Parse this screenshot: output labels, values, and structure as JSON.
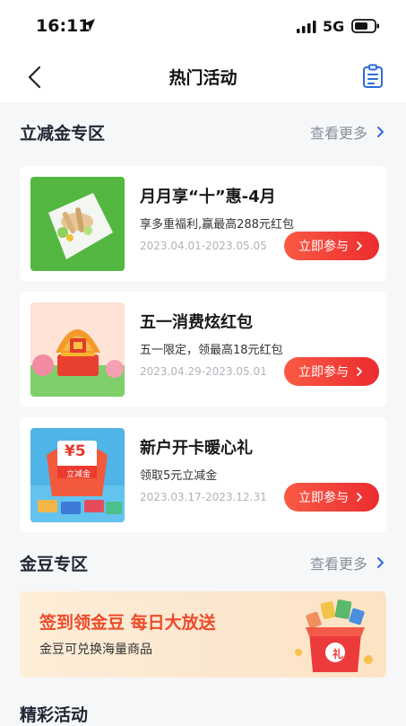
{
  "status_bar": {
    "time": "16:11",
    "network": "5G",
    "icons": [
      "location-arrow-icon",
      "signal-icon",
      "battery-icon"
    ]
  },
  "nav": {
    "title": "热门活动",
    "icons": [
      "back-icon",
      "document-icon"
    ]
  },
  "sections": {
    "discount": {
      "title": "立减金专区",
      "more": "查看更多"
    },
    "gold_beans": {
      "title": "金豆专区",
      "more": "查看更多"
    },
    "featured": {
      "title": "精彩活动"
    }
  },
  "activities": [
    {
      "title": "月月享“十”惠-4月",
      "desc": "享多重福利,赢最高288元红包",
      "date": "2023.04.01-2023.05.05",
      "button": "立即参与"
    },
    {
      "title": "五一消费炫红包",
      "desc": "五一限定，领最高18元红包",
      "date": "2023.04.29-2023.05.01",
      "button": "立即参与"
    },
    {
      "title": "新户开卡暖心礼",
      "desc": "领取5元立减金",
      "date": "2023.03.17-2023.12.31",
      "button": "立即参与"
    }
  ],
  "voucher_art": {
    "amount": "¥5",
    "label": "立减金"
  },
  "gold_banner": {
    "title": "签到领金豆  每日大放送",
    "subtitle": "金豆可兑换海量商品",
    "gift_char": "礼"
  },
  "colors": {
    "accent_red": "#ec2c2f",
    "title_dark": "#1f2733",
    "link_gray": "#8a8f99",
    "nav_blue": "#2f6bdc"
  }
}
